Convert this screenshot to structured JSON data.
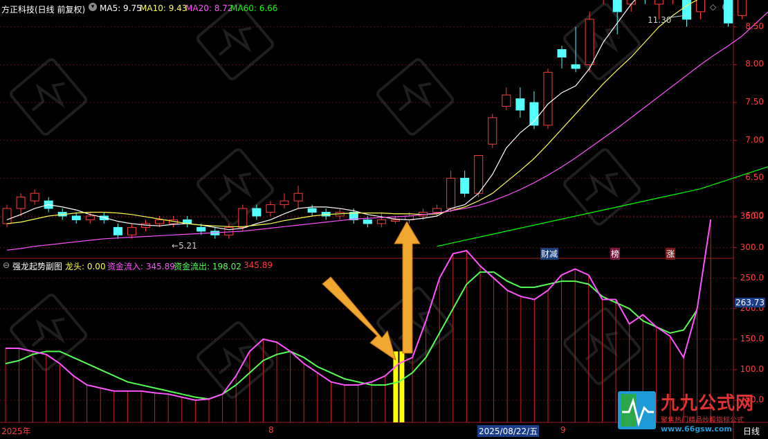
{
  "header": {
    "title": "方正科技(日线 前复权)",
    "ma5": "MA5: 9.75",
    "ma10": "MA10: 9.43",
    "ma20": "MA20: 8.72",
    "ma60": "MA60: 6.66"
  },
  "price_axis": [
    "11.00",
    "10.50",
    "10.00",
    "9.50",
    "9.00",
    "8.50",
    "8.00",
    "7.50",
    "7.00",
    "6.50",
    "6.00"
  ],
  "price_high_label": "11.30",
  "price_low_label": "5.21",
  "event_tags": [
    "财减",
    "榜",
    "涨"
  ],
  "indicator_header": {
    "name": "强龙起势副图",
    "longtou": "龙头: 0.00",
    "inflow": "资金流入: 345.89",
    "outflow": "资金流出: 198.02",
    "value": "345.89"
  },
  "indicator_axis": [
    "350.0",
    "300.0",
    "250.0",
    "200.0",
    "150.0",
    "100.0",
    "50.0"
  ],
  "indicator_current": "263.73",
  "date_axis": {
    "year": "2025年",
    "month8": "8",
    "date": "2025/08/22/五",
    "month9": "9",
    "period": "日线"
  },
  "watermark": {
    "title": "九九公式网",
    "sub": "聚焦热门精品炒股指标公式",
    "url": "www.66gsw.com"
  },
  "colors": {
    "up": "#ff3d3d",
    "down": "#54ffff",
    "ma5": "#ffffff",
    "ma10": "#ffff54",
    "ma20": "#ff54ff",
    "ma60": "#00ff00",
    "inflow": "#ff54ff",
    "outflow": "#54ff54"
  },
  "chart_data": {
    "type": "candlestick",
    "candles": [
      [
        5.9,
        6.1,
        5.85,
        6.15
      ],
      [
        6.1,
        6.25,
        6.0,
        6.3
      ],
      [
        6.2,
        6.3,
        6.15,
        6.35
      ],
      [
        6.2,
        6.1,
        6.05,
        6.25
      ],
      [
        6.05,
        6.0,
        5.95,
        6.1
      ],
      [
        6.0,
        5.95,
        5.9,
        6.05
      ],
      [
        5.95,
        6.0,
        5.9,
        6.05
      ],
      [
        6.0,
        5.95,
        5.9,
        6.05
      ],
      [
        5.85,
        5.75,
        5.7,
        5.9
      ],
      [
        5.75,
        5.85,
        5.7,
        5.9
      ],
      [
        5.85,
        5.9,
        5.8,
        5.95
      ],
      [
        5.9,
        5.95,
        5.85,
        6.0
      ],
      [
        5.9,
        5.95,
        5.85,
        6.0
      ],
      [
        5.95,
        5.9,
        5.85,
        6.0
      ],
      [
        5.85,
        5.8,
        5.75,
        5.9
      ],
      [
        5.8,
        5.75,
        5.7,
        5.85
      ],
      [
        5.75,
        5.85,
        5.7,
        5.9
      ],
      [
        5.85,
        6.1,
        5.8,
        6.15
      ],
      [
        6.1,
        6.0,
        5.95,
        6.15
      ],
      [
        6.05,
        6.15,
        6.0,
        6.2
      ],
      [
        6.15,
        6.2,
        6.1,
        6.3
      ],
      [
        6.2,
        6.3,
        6.1,
        6.4
      ],
      [
        6.1,
        6.05,
        6.0,
        6.15
      ],
      [
        6.05,
        6.0,
        5.95,
        6.1
      ],
      [
        6.0,
        6.05,
        5.95,
        6.1
      ],
      [
        6.05,
        5.95,
        5.9,
        6.1
      ],
      [
        5.95,
        5.9,
        5.85,
        6.0
      ],
      [
        5.9,
        5.95,
        5.85,
        6.05
      ],
      [
        5.95,
        5.95,
        5.9,
        6.0
      ],
      [
        5.95,
        6.0,
        5.9,
        6.05
      ],
      [
        6.0,
        6.05,
        5.95,
        6.1
      ],
      [
        6.05,
        6.1,
        6.0,
        6.15
      ],
      [
        6.1,
        6.5,
        6.05,
        6.6
      ],
      [
        6.5,
        6.3,
        6.25,
        6.6
      ],
      [
        6.3,
        6.8,
        6.25,
        6.8
      ],
      [
        6.95,
        7.3,
        6.9,
        7.35
      ],
      [
        7.45,
        7.6,
        7.4,
        7.7
      ],
      [
        7.55,
        7.4,
        7.3,
        7.7
      ],
      [
        7.5,
        7.2,
        7.15,
        7.65
      ],
      [
        7.2,
        7.9,
        7.15,
        7.95
      ],
      [
        8.2,
        8.1,
        7.95,
        8.25
      ],
      [
        8.0,
        7.95,
        7.9,
        8.5
      ],
      [
        8.0,
        8.6,
        7.9,
        8.7
      ],
      [
        8.9,
        9.3,
        8.8,
        9.45
      ],
      [
        8.9,
        8.7,
        8.4,
        9.0
      ],
      [
        8.8,
        9.3,
        8.7,
        9.55
      ],
      [
        9.1,
        8.9,
        8.8,
        9.6
      ],
      [
        8.8,
        9.2,
        8.6,
        9.5
      ],
      [
        8.9,
        9.4,
        8.8,
        9.6
      ],
      [
        9.5,
        8.6,
        8.5,
        9.7
      ],
      [
        8.7,
        9.6,
        8.6,
        9.7
      ],
      [
        9.5,
        9.3,
        9.2,
        9.55
      ],
      [
        9.2,
        8.55,
        8.5,
        9.3
      ],
      [
        8.65,
        9.35,
        8.6,
        9.4
      ],
      [
        9.4,
        10.3,
        9.3,
        10.3
      ],
      [
        10.6,
        11.3,
        10.5,
        11.3
      ]
    ],
    "ma5": [
      5.95,
      6.02,
      6.1,
      6.15,
      6.12,
      6.08,
      6.02,
      5.98,
      5.93,
      5.9,
      5.88,
      5.87,
      5.89,
      5.9,
      5.88,
      5.85,
      5.82,
      5.84,
      5.9,
      5.95,
      6.03,
      6.1,
      6.12,
      6.12,
      6.1,
      6.07,
      6.02,
      5.99,
      5.96,
      5.95,
      5.97,
      6.0,
      6.1,
      6.15,
      6.3,
      6.55,
      6.9,
      7.1,
      7.25,
      7.48,
      7.63,
      7.72,
      7.95,
      8.3,
      8.55,
      8.8,
      9.0,
      9.08,
      9.13,
      9.08,
      9.1,
      9.22,
      9.17,
      9.15,
      9.35,
      9.75
    ],
    "ma10": [
      5.9,
      5.92,
      5.96,
      6.0,
      6.02,
      6.04,
      6.05,
      6.05,
      6.04,
      6.02,
      5.99,
      5.96,
      5.93,
      5.9,
      5.88,
      5.87,
      5.86,
      5.86,
      5.88,
      5.9,
      5.94,
      5.97,
      6.0,
      6.02,
      6.03,
      6.04,
      6.04,
      6.04,
      6.03,
      6.03,
      6.02,
      6.03,
      6.07,
      6.12,
      6.2,
      6.3,
      6.45,
      6.6,
      6.76,
      6.95,
      7.15,
      7.35,
      7.55,
      7.75,
      7.93,
      8.1,
      8.3,
      8.5,
      8.65,
      8.78,
      8.88,
      8.95,
      9.0,
      9.05,
      9.2,
      9.43
    ],
    "ma20": [
      5.55,
      5.57,
      5.6,
      5.62,
      5.64,
      5.66,
      5.68,
      5.7,
      5.71,
      5.72,
      5.73,
      5.74,
      5.75,
      5.76,
      5.77,
      5.78,
      5.79,
      5.8,
      5.82,
      5.84,
      5.86,
      5.88,
      5.9,
      5.92,
      5.94,
      5.96,
      5.97,
      5.98,
      5.99,
      6.0,
      6.02,
      6.04,
      6.07,
      6.1,
      6.14,
      6.2,
      6.27,
      6.35,
      6.44,
      6.54,
      6.65,
      6.77,
      6.9,
      7.03,
      7.16,
      7.3,
      7.44,
      7.58,
      7.72,
      7.86,
      8.0,
      8.13,
      8.25,
      8.38,
      8.55,
      8.72
    ],
    "ma60": [
      5.6,
      5.64,
      5.68,
      5.72,
      5.76,
      5.8,
      5.84,
      5.88,
      5.92,
      5.96,
      6.0,
      6.04,
      6.08,
      6.12,
      6.16,
      6.2,
      6.24,
      6.28,
      6.32,
      6.36,
      6.42,
      6.48,
      6.54,
      6.6,
      6.66
    ],
    "inflow": [
      135,
      135,
      130,
      125,
      110,
      90,
      75,
      70,
      65,
      65,
      65,
      62,
      60,
      55,
      50,
      52,
      60,
      90,
      130,
      150,
      145,
      130,
      110,
      95,
      80,
      75,
      75,
      80,
      90,
      110,
      120,
      180,
      250,
      290,
      295,
      270,
      250,
      230,
      220,
      215,
      230,
      255,
      265,
      255,
      215,
      215,
      175,
      190,
      170,
      155,
      120,
      200,
      346
    ],
    "outflow": [
      110,
      115,
      125,
      130,
      130,
      120,
      110,
      100,
      90,
      80,
      75,
      70,
      65,
      60,
      55,
      52,
      60,
      75,
      95,
      115,
      125,
      130,
      120,
      105,
      95,
      85,
      80,
      75,
      75,
      80,
      95,
      120,
      160,
      200,
      240,
      260,
      260,
      245,
      235,
      235,
      240,
      245,
      245,
      240,
      220,
      210,
      200,
      180,
      170,
      160,
      165,
      198
    ],
    "highlight_index": 29
  }
}
